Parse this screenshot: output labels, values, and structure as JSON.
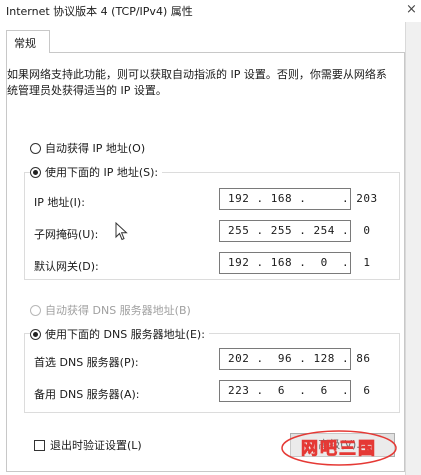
{
  "window": {
    "title": "Internet 协议版本 4 (TCP/IPv4) 属性",
    "close_glyph": "×"
  },
  "tabs": [
    {
      "label": "常规",
      "selected": true
    }
  ],
  "description": "如果网络支持此功能，则可以获取自动指派的 IP 设置。否则，你需要从网络系统管理员处获得适当的 IP 设置。",
  "ip_section": {
    "auto_label": "自动获得 IP 地址(O)",
    "manual_label": "使用下面的 IP 地址(S):",
    "selected": "manual",
    "fields": [
      {
        "label": "IP 地址(I):",
        "value": "192 . 168 .     . 203"
      },
      {
        "label": "子网掩码(U):",
        "value": "255 . 255 . 254 .  0"
      },
      {
        "label": "默认网关(D):",
        "value": "192 . 168 .  0  .  1"
      }
    ]
  },
  "dns_section": {
    "auto_label": "自动获得 DNS 服务器地址(B)",
    "manual_label": "使用下面的 DNS 服务器地址(E):",
    "selected": "manual",
    "fields": [
      {
        "label": "首选 DNS 服务器(P):",
        "value": "202 .  96 . 128 . 86"
      },
      {
        "label": "备用 DNS 服务器(A):",
        "value": "223 .  6  .  6  .  6"
      }
    ]
  },
  "validate_checkbox": {
    "label": "退出时验证设置(L)",
    "checked": false
  },
  "advanced_button": {
    "label": "高级(V)..."
  },
  "watermark": {
    "text": "网吧三国",
    "color": "#e53935"
  },
  "colors": {
    "border": "#c8c8c8",
    "disabled_text": "#a0a0a0",
    "button_bg": "#e1e1e1"
  }
}
